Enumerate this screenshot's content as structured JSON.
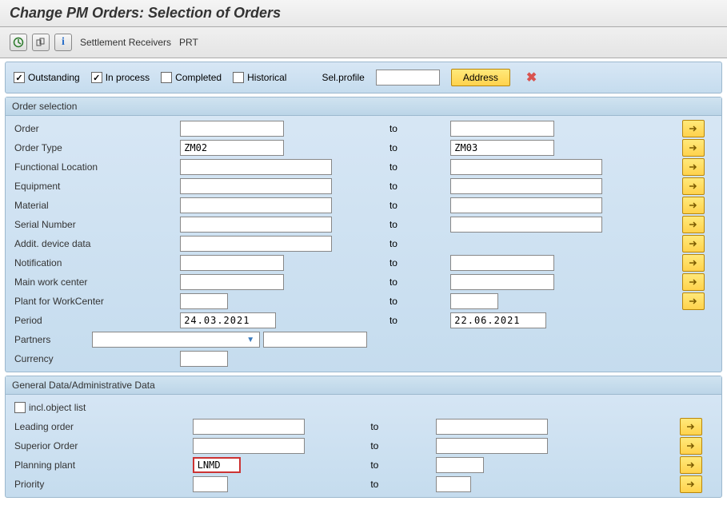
{
  "title": "Change PM Orders: Selection of Orders",
  "toolbar": {
    "settlement_receivers": "Settlement Receivers",
    "prt": "PRT"
  },
  "status": {
    "outstanding": "Outstanding",
    "in_process": "In process",
    "completed": "Completed",
    "historical": "Historical",
    "sel_profile_label": "Sel.profile",
    "sel_profile_value": "",
    "address_btn": "Address"
  },
  "section1": {
    "header": "Order selection",
    "rows": {
      "order": {
        "label": "Order",
        "from": "",
        "to_label": "to",
        "to": ""
      },
      "order_type": {
        "label": "Order Type",
        "from": "ZM02",
        "to_label": "to",
        "to": "ZM03"
      },
      "func_loc": {
        "label": "Functional Location",
        "from": "",
        "to_label": "to",
        "to": ""
      },
      "equipment": {
        "label": "Equipment",
        "from": "",
        "to_label": "to",
        "to": ""
      },
      "material": {
        "label": "Material",
        "from": "",
        "to_label": "to",
        "to": ""
      },
      "serial_number": {
        "label": "Serial Number",
        "from": "",
        "to_label": "to",
        "to": ""
      },
      "addit_device": {
        "label": "Addit. device data",
        "from": "",
        "to_label": "to",
        "to": ""
      },
      "notification": {
        "label": "Notification",
        "from": "",
        "to_label": "to",
        "to": ""
      },
      "main_work_center": {
        "label": "Main work center",
        "from": "",
        "to_label": "to",
        "to": ""
      },
      "plant_wc": {
        "label": "Plant for WorkCenter",
        "from": "",
        "to_label": "to",
        "to": ""
      },
      "period": {
        "label": "Period",
        "from": "24.03.2021",
        "to_label": "to",
        "to": "22.06.2021"
      },
      "partners": {
        "label": "Partners",
        "dropdown": "",
        "value": ""
      },
      "currency": {
        "label": "Currency",
        "value": ""
      }
    }
  },
  "section2": {
    "header": "General Data/Administrative Data",
    "incl_object_list": "incl.object list",
    "rows": {
      "leading_order": {
        "label": "Leading order",
        "from": "",
        "to_label": "to",
        "to": ""
      },
      "superior_order": {
        "label": "Superior Order",
        "from": "",
        "to_label": "to",
        "to": ""
      },
      "planning_plant": {
        "label": "Planning plant",
        "from": "LNMD",
        "to_label": "to",
        "to": ""
      },
      "priority": {
        "label": "Priority",
        "from": "",
        "to_label": "to",
        "to": ""
      }
    }
  }
}
